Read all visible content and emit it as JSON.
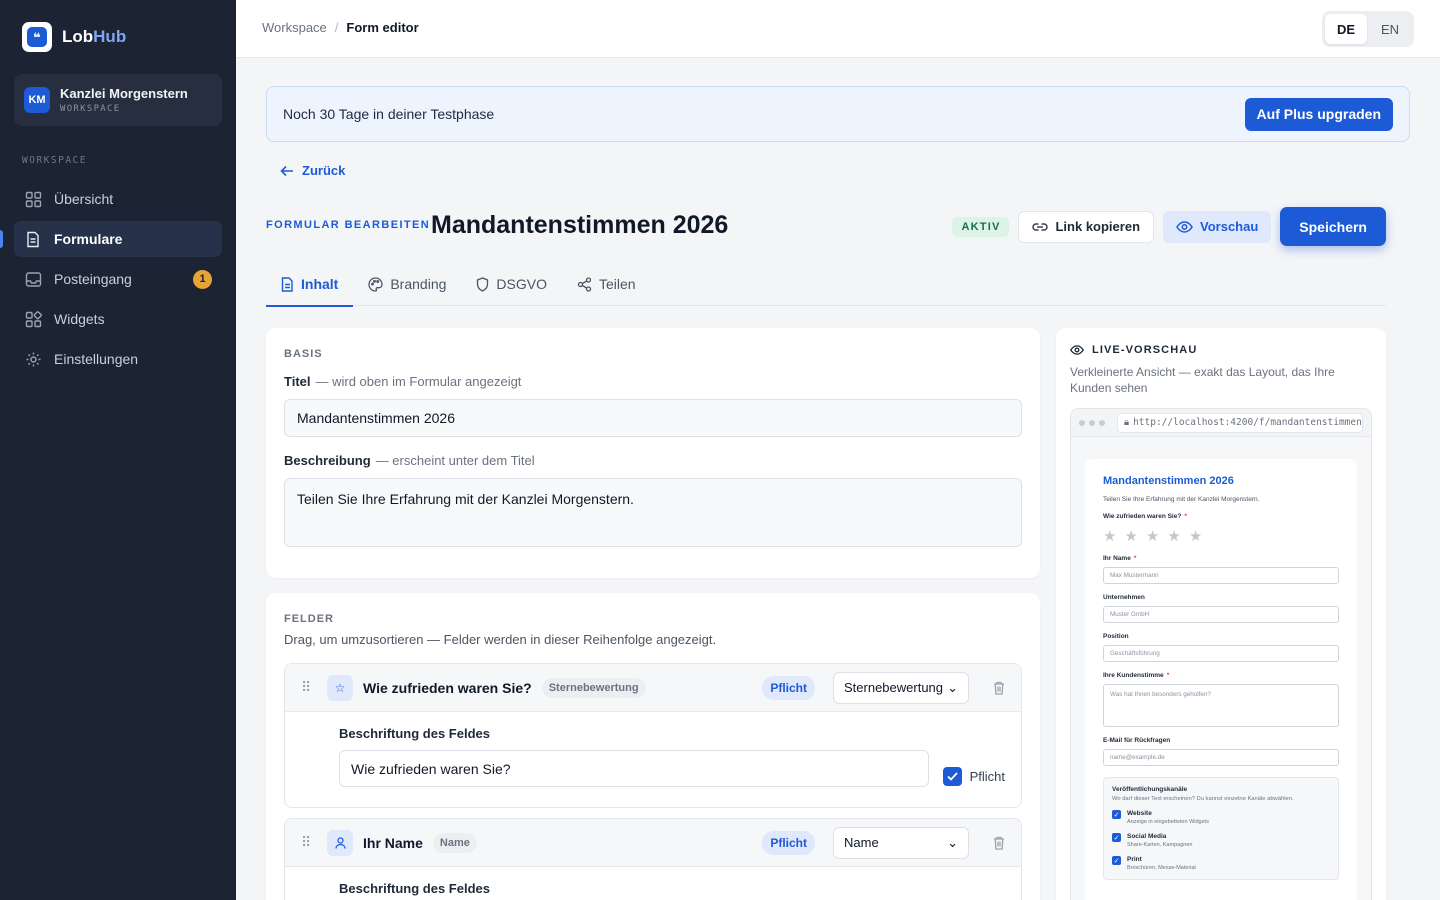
{
  "brand": {
    "name_part1": "Lob",
    "name_part2": "Hub",
    "logo_glyph": "❝"
  },
  "workspace": {
    "initials": "KM",
    "name": "Kanzlei Morgenstern",
    "role": "WORKSPACE"
  },
  "sidebar": {
    "section_label": "WORKSPACE",
    "items": [
      {
        "label": "Übersicht",
        "icon": "grid-icon"
      },
      {
        "label": "Formulare",
        "icon": "document-icon",
        "active": true
      },
      {
        "label": "Posteingang",
        "icon": "inbox-icon",
        "badge": "1"
      },
      {
        "label": "Widgets",
        "icon": "widgets-icon"
      },
      {
        "label": "Einstellungen",
        "icon": "gear-icon"
      }
    ]
  },
  "breadcrumb": {
    "parent": "Workspace",
    "separator": "/",
    "current": "Form editor"
  },
  "language": {
    "options": [
      "DE",
      "EN"
    ],
    "selected": "DE"
  },
  "trial": {
    "text": "Noch 30 Tage in deiner Testphase",
    "button": "Auf Plus upgraden"
  },
  "back_label": "Zurück",
  "header": {
    "eyebrow": "FORMULAR BEARBEITEN",
    "title": "Mandantenstimmen 2026",
    "status": "AKTIV",
    "copy_link": "Link kopieren",
    "preview": "Vorschau",
    "save": "Speichern"
  },
  "tabs": [
    {
      "label": "Inhalt",
      "icon": "document-icon",
      "active": true
    },
    {
      "label": "Branding",
      "icon": "palette-icon"
    },
    {
      "label": "DSGVO",
      "icon": "shield-icon"
    },
    {
      "label": "Teilen",
      "icon": "share-icon"
    }
  ],
  "basis": {
    "section": "BASIS",
    "title_label": "Titel",
    "title_hint": "— wird oben im Formular angezeigt",
    "title_value": "Mandantenstimmen 2026",
    "desc_label": "Beschreibung",
    "desc_hint": "— erscheint unter dem Titel",
    "desc_value": "Teilen Sie Ihre Erfahrung mit der Kanzlei Morgenstern."
  },
  "felder": {
    "section": "FELDER",
    "subtitle": "Drag, um umzusortieren — Felder werden in dieser Reihenfolge angezeigt.",
    "fields": [
      {
        "title": "Wie zufrieden waren Sie?",
        "type": "Sternebewertung",
        "required_badge": "Pflicht",
        "select": "Sternebewertung",
        "label_caption": "Beschriftung des Feldes",
        "label_value": "Wie zufrieden waren Sie?",
        "checkbox_label": "Pflicht",
        "icon": "star-icon"
      },
      {
        "title": "Ihr Name",
        "type": "Name",
        "required_badge": "Pflicht",
        "select": "Name",
        "label_caption": "Beschriftung des Feldes",
        "icon": "person-icon"
      }
    ]
  },
  "preview": {
    "heading": "LIVE-VORSCHAU",
    "subtitle": "Verkleinerte Ansicht — exakt das Layout, das Ihre Kunden sehen",
    "url": "http://localhost:4200/f/mandantenstimmen",
    "form": {
      "title": "Mandantenstimmen 2026",
      "desc": "Teilen Sie Ihre Erfahrung mit der Kanzlei Morgenstern.",
      "q_rating": "Wie zufrieden waren Sie?",
      "stars": 5,
      "name_label": "Ihr Name",
      "name_placeholder": "Max Mustermann",
      "company_label": "Unternehmen",
      "company_placeholder": "Muster GmbH",
      "position_label": "Position",
      "position_placeholder": "Geschäftsführung",
      "voice_label": "Ihre Kundenstimme",
      "voice_placeholder": "Was hat Ihnen besonders geholfen?",
      "email_label": "E-Mail für Rückfragen",
      "email_placeholder": "name@example.de",
      "channels_title": "Veröffentlichungskanäle",
      "channels_sub": "Wo darf dieser Text erscheinen? Du kannst einzelne Kanäle abwählen.",
      "channels": [
        {
          "name": "Website",
          "desc": "Anzeige in eingebetteten Widgets"
        },
        {
          "name": "Social Media",
          "desc": "Share-Karten, Kampagnen"
        },
        {
          "name": "Print",
          "desc": "Broschüren, Messe-Material"
        }
      ]
    }
  },
  "colors": {
    "sidebar_bg": "#1c2333",
    "accent": "#1d5bd6",
    "badge": "#e6a534",
    "active_green": "#15704a"
  }
}
